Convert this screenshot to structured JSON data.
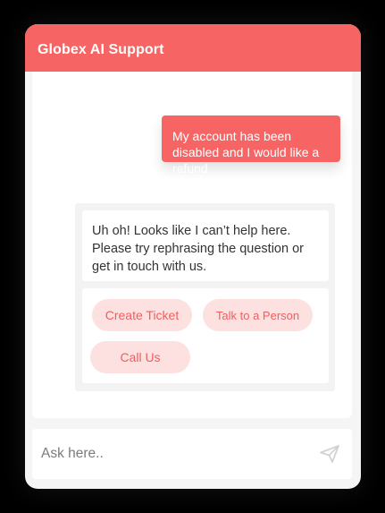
{
  "header": {
    "title": "Globex AI Support"
  },
  "conversation": {
    "user_message": "My account has been disabled and I would like a refund.",
    "bot_message": "Uh oh! Looks like I can’t help here. Please try rephrasing the question or get in touch with us."
  },
  "options": [
    {
      "label": "Create Ticket"
    },
    {
      "label": "Talk to a Person"
    },
    {
      "label": "Call Us"
    }
  ],
  "input": {
    "placeholder": "Ask here..",
    "value": ""
  },
  "icons": {
    "send": "send-icon"
  },
  "colors": {
    "accent": "#f76464",
    "option_bg": "#fde0e0",
    "option_text": "#f05f5f"
  }
}
